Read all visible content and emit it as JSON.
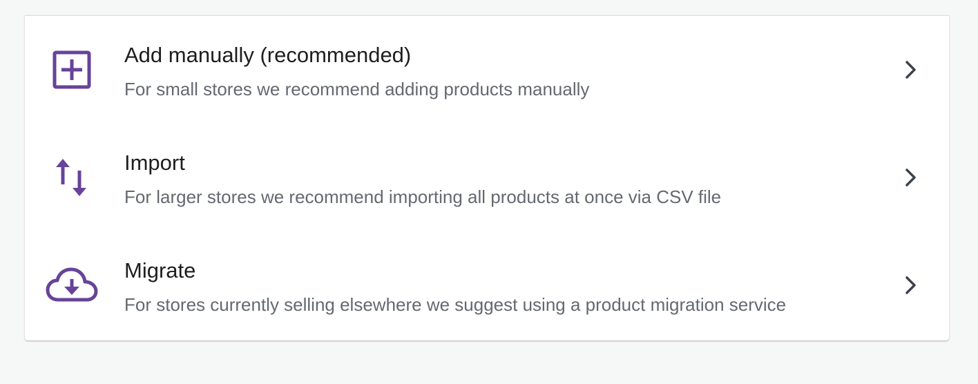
{
  "accent_color": "#674399",
  "options": [
    {
      "icon": "plus-square-icon",
      "title": "Add manually (recommended)",
      "description": "For small stores we recommend adding products manually"
    },
    {
      "icon": "arrows-up-down-icon",
      "title": "Import",
      "description": "For larger stores we recommend importing all products at once via CSV file"
    },
    {
      "icon": "cloud-download-icon",
      "title": "Migrate",
      "description": "For stores currently selling elsewhere we suggest using a product migration service"
    }
  ],
  "chevron_icon": "chevron-right-icon"
}
